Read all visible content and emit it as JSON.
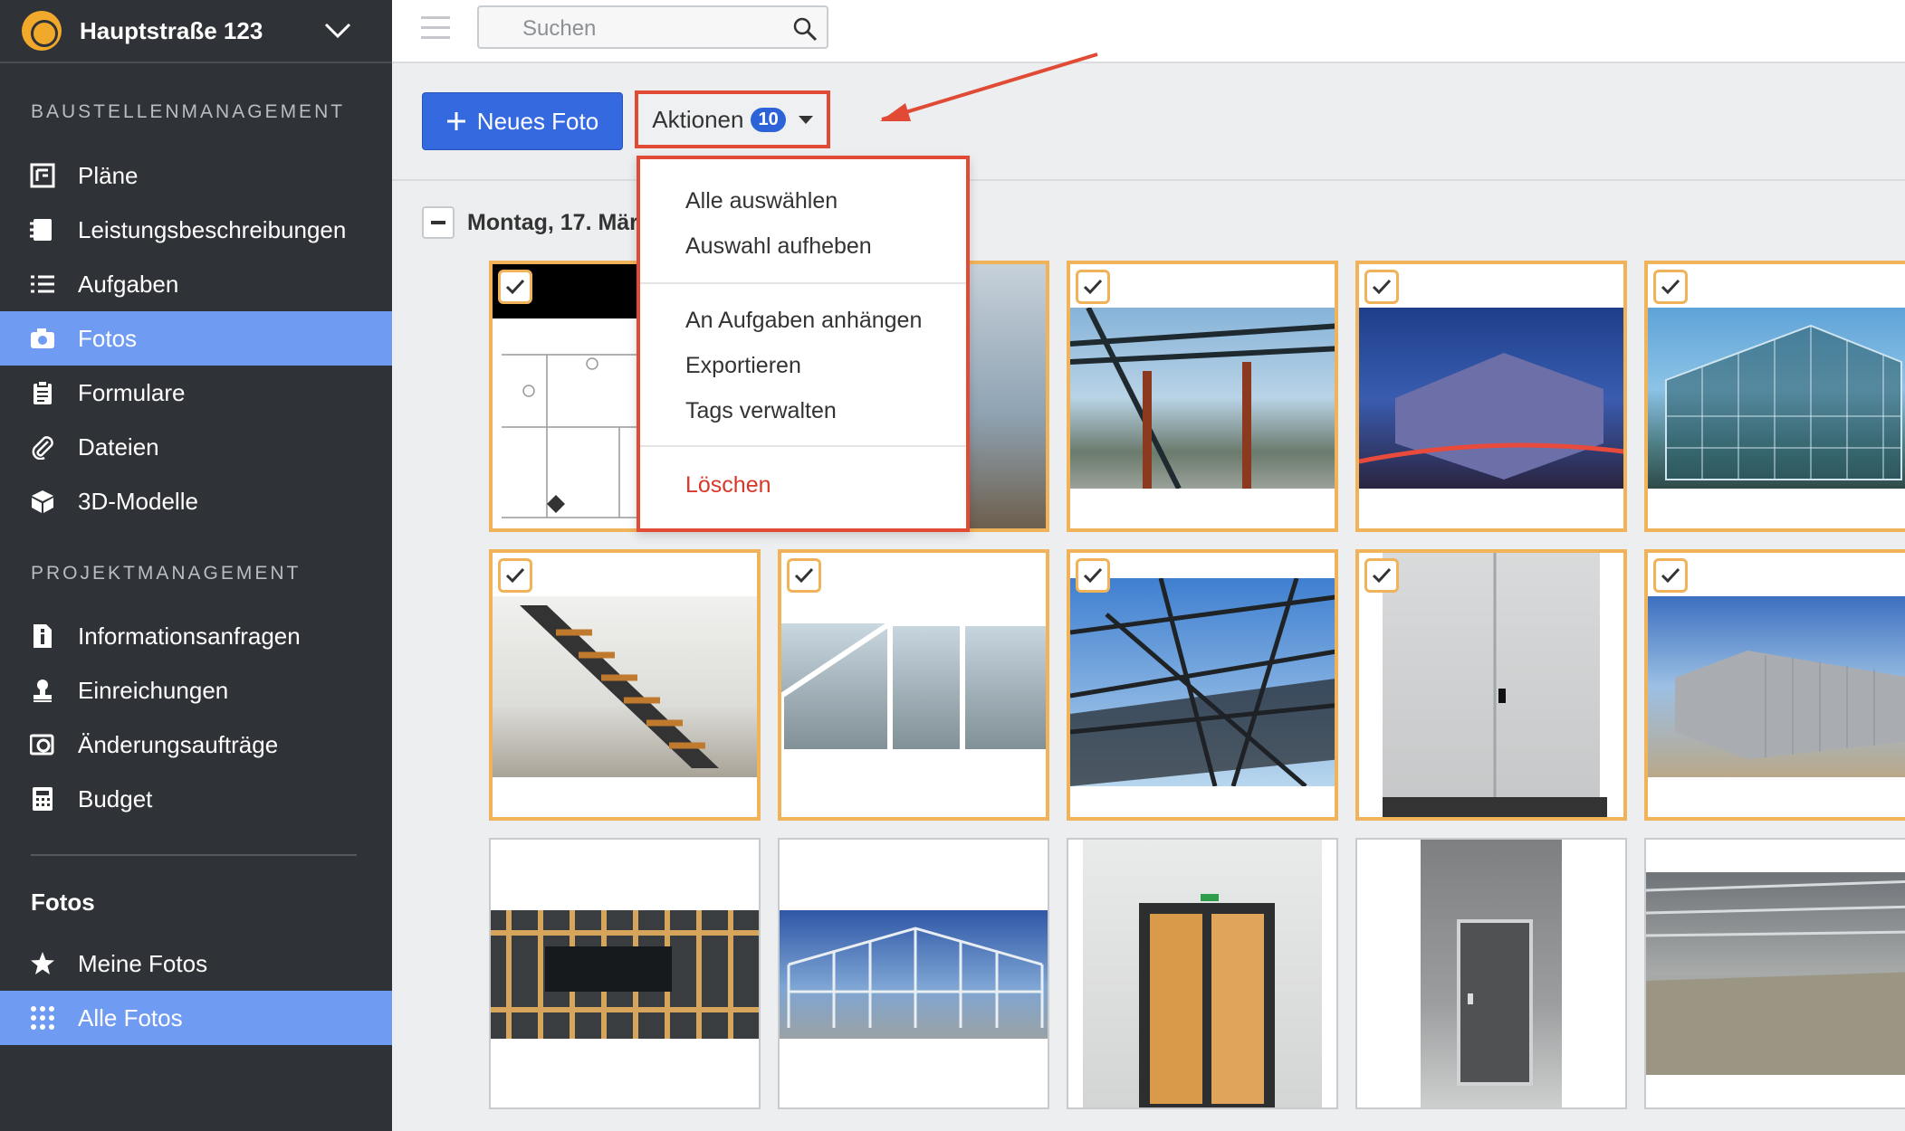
{
  "project": {
    "name": "Hauptstraße 123"
  },
  "sidebar": {
    "section1": "BAUSTELLENMANAGEMENT",
    "items1": [
      {
        "label": "Pläne",
        "icon": "plans-icon"
      },
      {
        "label": "Leistungsbeschreibungen",
        "icon": "specs-icon"
      },
      {
        "label": "Aufgaben",
        "icon": "list-icon"
      },
      {
        "label": "Fotos",
        "icon": "camera-icon",
        "active": true
      },
      {
        "label": "Formulare",
        "icon": "clipboard-icon"
      },
      {
        "label": "Dateien",
        "icon": "paperclip-icon"
      },
      {
        "label": "3D-Modelle",
        "icon": "cube-icon"
      }
    ],
    "section2": "PROJEKTMANAGEMENT",
    "items2": [
      {
        "label": "Informationsanfragen",
        "icon": "info-icon"
      },
      {
        "label": "Einreichungen",
        "icon": "stamp-icon"
      },
      {
        "label": "Änderungsaufträge",
        "icon": "change-icon"
      },
      {
        "label": "Budget",
        "icon": "calculator-icon"
      }
    ],
    "section3": "Fotos",
    "items3": [
      {
        "label": "Meine Fotos",
        "icon": "star-icon"
      },
      {
        "label": "Alle Fotos",
        "icon": "grid-icon",
        "active": true
      }
    ]
  },
  "search": {
    "placeholder": "Suchen"
  },
  "toolbar": {
    "new_photo": "Neues Foto",
    "actions": "Aktionen",
    "actions_count": "10"
  },
  "date_group": "Montag, 17. Mär",
  "dropdown": {
    "select_all": "Alle auswählen",
    "deselect": "Auswahl aufheben",
    "attach": "An Aufgaben anhängen",
    "export": "Exportieren",
    "tags": "Tags verwalten",
    "delete": "Löschen"
  },
  "colors": {
    "accent": "#3469e0",
    "sidebar": "#2f3236",
    "active": "#6f9bf2",
    "selection": "#f0b35a",
    "highlight": "#e14b35"
  }
}
